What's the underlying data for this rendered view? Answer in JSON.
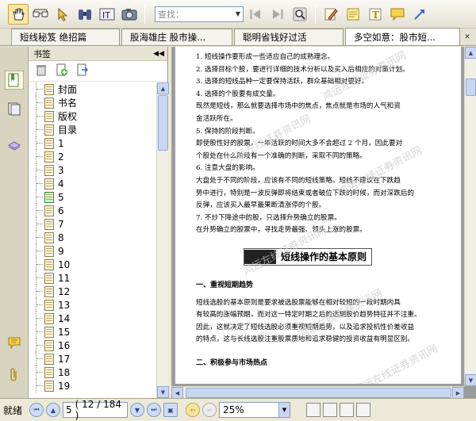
{
  "toolbar": {
    "find_placeholder": "查找：",
    "buttons": [
      "hand-tool",
      "reading-glasses",
      "select-arrow",
      "binoculars",
      "text-select",
      "snapshot",
      "nav-back",
      "nav-forward",
      "find",
      "pencil-edit",
      "highlight-note",
      "text-box",
      "comment",
      "arrow-tool"
    ]
  },
  "tabs": [
    {
      "label": "短线秘笈 绝招篇",
      "active": false
    },
    {
      "label": "股海雄庄 股市操...",
      "active": false
    },
    {
      "label": "聪明省钱好过活",
      "active": false
    },
    {
      "label": "多空如意：股市短...",
      "active": true
    }
  ],
  "bookmarks": {
    "title": "书签",
    "items": [
      "封面",
      "书名",
      "版权",
      "目录",
      "1",
      "2",
      "3",
      "4",
      "5",
      "6",
      "7",
      "8",
      "9",
      "10",
      "11",
      "12",
      "13",
      "14",
      "15",
      "16",
      "17",
      "18",
      "19"
    ],
    "current_index": 8
  },
  "document": {
    "lines": [
      "1. 短线操作要形成一些适应自己的成熟理念。",
      "2. 选择目标个股，要进行详细的技术分析以及买入后相应的对策计划。",
      "3. 选择的短线品种一定要保持活跃，群众基础相对要好。",
      "4. 选择的个股要有成交量。",
      "既然是短线，那么就要选择市场中的焦点，焦点就是市场的人气和资",
      "金活跃所在。",
      "5. 保持的阶段判断。",
      "即使股性好的股票，一年活跃的时间大多不会超过 2 个月，因此要对",
      "个股处在什么阶段有一个准确的判断，采取不同的策略。",
      "6. 注意大盘的影响。",
      "大盘处于不同的阶段，应该有不同的短线策略。短线不建议在下跌趋",
      "势中进行，特别是一波反弹即将结束或者破位下跌的时候，而对深跌后的",
      "反弹，应该买入最早最果断清涨停的个股。",
      "7. 不炒下降途中的股，只选择升势确立的股票。",
      "在升势确立的股票中，寻找走势最强、领头上涨的股票。"
    ],
    "heading": "短线操作的基本原则",
    "section1_title": "一、重视短期趋势",
    "section1_lines": [
      "短线选股的基本原则是要求被选股票能够在相对较短的一段时期内具",
      "有较高的涨幅预期，而对这一特定时期之后的远期股价趋势特征并不注重。",
      "因此，这就决定了短线选股必须重视短期趋势，以及追求投机性价差收益",
      "的特点，这与长线选股注重股票质地和追求稳健的投资收益有明显区别。"
    ],
    "section2_title": "二、积极参与市场热点",
    "watermark": "鸿运左线证券资讯网"
  },
  "status": {
    "ready": "就绪",
    "page_current": "5",
    "page_info": "( 12 / 184 )",
    "zoom": "25%"
  }
}
